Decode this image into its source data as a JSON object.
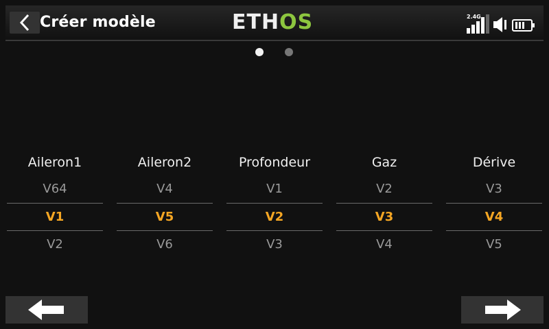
{
  "header": {
    "title": "Créer modèle",
    "logo_left": "ETH",
    "logo_right": "OS",
    "rf_band": "2.4G",
    "back_icon": "chevron-left-icon",
    "status_icons": [
      "signal-bars-icon",
      "speaker-icon",
      "battery-icon"
    ]
  },
  "pager": {
    "pages": 2,
    "current": 1
  },
  "channels": [
    {
      "name": "Aileron1",
      "prev": "V64",
      "selected": "V1",
      "next": "V2"
    },
    {
      "name": "Aileron2",
      "prev": "V4",
      "selected": "V5",
      "next": "V6"
    },
    {
      "name": "Profondeur",
      "prev": "V1",
      "selected": "V2",
      "next": "V3"
    },
    {
      "name": "Gaz",
      "prev": "V2",
      "selected": "V3",
      "next": "V4"
    },
    {
      "name": "Dérive",
      "prev": "V3",
      "selected": "V4",
      "next": "V5"
    }
  ],
  "footer": {
    "prev_icon": "arrow-left-icon",
    "next_icon": "arrow-right-icon"
  },
  "colors": {
    "selected": "#f5a623",
    "logo_accent": "#8dc63f",
    "background": "#111111"
  }
}
